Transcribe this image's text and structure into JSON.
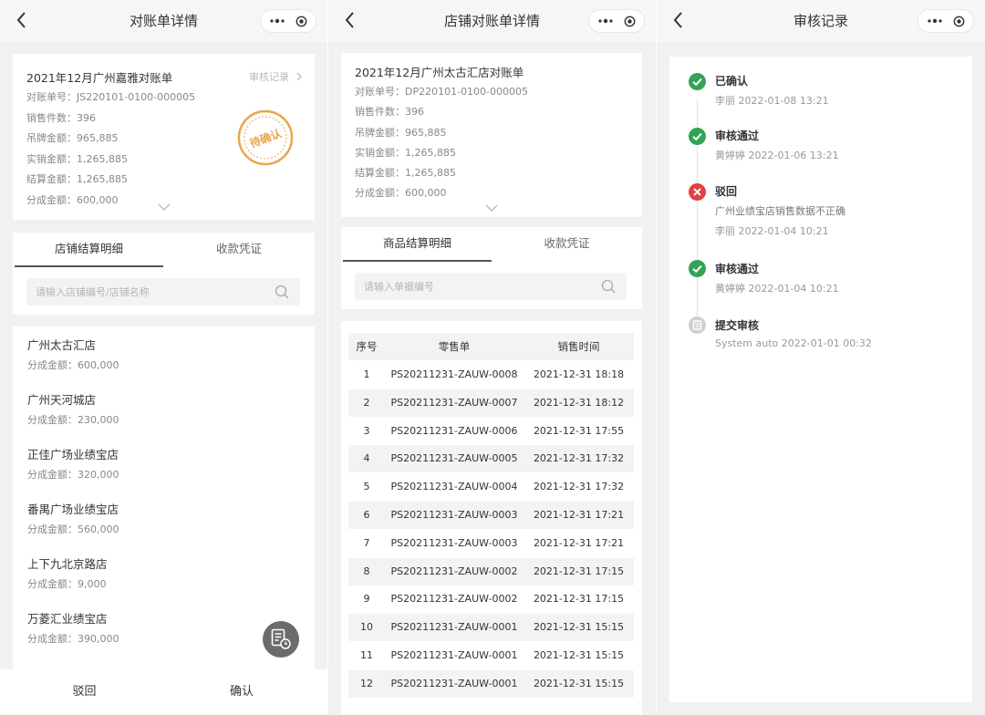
{
  "panel1": {
    "nav_title": "对账单详情",
    "summary": {
      "title": "2021年12月广州嘉雅对账单",
      "audit_link": "审核记录",
      "stamp": "待确认",
      "lines": [
        "对账单号：JS220101-0100-000005",
        "销售件数：396",
        "吊牌金额：965,885",
        "实销金额：1,265,885",
        "结算金额：1,265,885",
        "分成金额：600,000"
      ]
    },
    "tabs": [
      "店铺结算明细",
      "收款凭证"
    ],
    "search_placeholder": "请输入店铺编号/店铺名称",
    "stores": [
      {
        "name": "广州太古汇店",
        "amount": "分成金额：600,000"
      },
      {
        "name": "广州天河城店",
        "amount": "分成金额：230,000"
      },
      {
        "name": "正佳广场业绩宝店",
        "amount": "分成金额：320,000"
      },
      {
        "name": "番禺广场业绩宝店",
        "amount": "分成金额：560,000"
      },
      {
        "name": "上下九北京路店",
        "amount": "分成金额：9,000"
      },
      {
        "name": "万菱汇业绩宝店",
        "amount": "分成金额：390,000"
      }
    ],
    "reject_label": "驳回",
    "confirm_label": "确认"
  },
  "panel2": {
    "nav_title": "店铺对账单详情",
    "summary": {
      "title": "2021年12月广州太古汇店对账单",
      "lines": [
        "对账单号：DP220101-0100-000005",
        "销售件数：396",
        "吊牌金额：965,885",
        "实销金额：1,265,885",
        "结算金额：1,265,885",
        "分成金额：600,000"
      ]
    },
    "tabs": [
      "商品结算明细",
      "收款凭证"
    ],
    "search_placeholder": "请输入单据编号",
    "table": {
      "headers": [
        "序号",
        "零售单",
        "销售时间"
      ],
      "rows": [
        [
          "1",
          "PS20211231-ZAUW-0008",
          "2021-12-31 18:18"
        ],
        [
          "2",
          "PS20211231-ZAUW-0007",
          "2021-12-31 18:12"
        ],
        [
          "3",
          "PS20211231-ZAUW-0006",
          "2021-12-31 17:55"
        ],
        [
          "4",
          "PS20211231-ZAUW-0005",
          "2021-12-31 17:32"
        ],
        [
          "5",
          "PS20211231-ZAUW-0004",
          "2021-12-31 17:32"
        ],
        [
          "6",
          "PS20211231-ZAUW-0003",
          "2021-12-31 17:21"
        ],
        [
          "7",
          "PS20211231-ZAUW-0003",
          "2021-12-31 17:21"
        ],
        [
          "8",
          "PS20211231-ZAUW-0002",
          "2021-12-31 17:15"
        ],
        [
          "9",
          "PS20211231-ZAUW-0002",
          "2021-12-31 17:15"
        ],
        [
          "10",
          "PS20211231-ZAUW-0001",
          "2021-12-31 15:15"
        ],
        [
          "11",
          "PS20211231-ZAUW-0001",
          "2021-12-31 15:15"
        ],
        [
          "12",
          "PS20211231-ZAUW-0001",
          "2021-12-31 15:15"
        ]
      ]
    }
  },
  "panel3": {
    "nav_title": "审核记录",
    "records": [
      {
        "status": "success",
        "title": "已确认",
        "meta": "李丽   2022-01-08 13:21"
      },
      {
        "status": "success",
        "title": "审核通过",
        "meta": "黄婷婷   2022-01-06 13:21"
      },
      {
        "status": "reject",
        "title": "驳回",
        "note": "广州业绩宝店销售数据不正确",
        "meta": "李丽   2022-01-04 10:21"
      },
      {
        "status": "success",
        "title": "审核通过",
        "meta": "黄婷婷   2022-01-04 10:21"
      },
      {
        "status": "submit",
        "title": "提交审核",
        "meta": "System   auto   2022-01-01 00:32"
      }
    ]
  },
  "colors": {
    "success": "#33a356",
    "reject": "#e04040",
    "submit": "#cfcfcf",
    "stamp": "#e9a64a"
  }
}
